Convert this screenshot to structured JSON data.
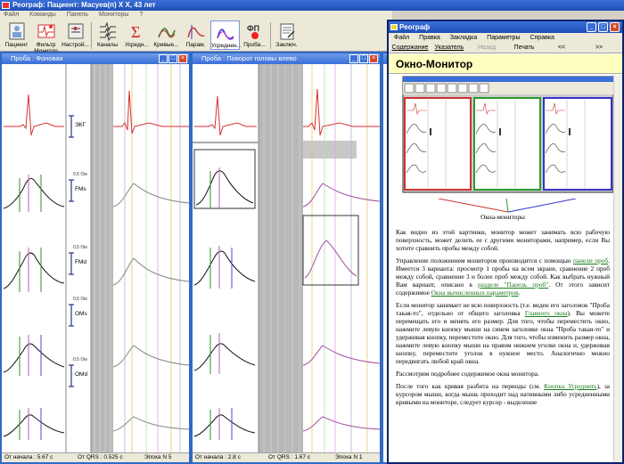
{
  "main_window": {
    "title": "Реограф: Пациент: Масуев(п) Х Х, 43 лет",
    "menu": [
      "Файл",
      "Команды",
      "Панель",
      "Мониторы",
      "?"
    ],
    "toolbar": [
      {
        "label": "Пациент",
        "icon": "patient-icon"
      },
      {
        "label": "Фильтр Монитор",
        "icon": "monitor-filter-icon"
      },
      {
        "label": "Настрой...",
        "icon": "settings-icon"
      },
      {
        "label": "Каналы",
        "icon": "channels-icon"
      },
      {
        "label": "Усредн...",
        "icon": "sigma-icon"
      },
      {
        "label": "Кривые...",
        "icon": "curves-icon"
      },
      {
        "label": "Парам.",
        "icon": "params-icon"
      },
      {
        "label": "Усреднен...",
        "icon": "averaged-icon"
      },
      {
        "label": "Проба...",
        "icon": "probe-icon"
      },
      {
        "label": "Заключ.",
        "icon": "conclusion-icon"
      }
    ]
  },
  "monitors": [
    {
      "title": "Проба : Фоновая",
      "status": {
        "start": "От начала : 5.67 с",
        "qrs": "От QRS : 0.525 с",
        "epoch": "Эпоха N 5"
      }
    },
    {
      "title": "Проба : Поворот головы влево",
      "status": {
        "start": "От начала : 2.8 с",
        "qrs": "От QRS : 1.67 с",
        "epoch": "Эпоха N 1"
      }
    }
  ],
  "leads": [
    {
      "label": "ЭКГ",
      "scale": ""
    },
    {
      "label": "FMs",
      "scale": "0,5 Ом"
    },
    {
      "label": "FMd",
      "scale": "0,5 Ом"
    },
    {
      "label": "OMs",
      "scale": "0,5 Ом"
    },
    {
      "label": "OMd",
      "scale": "0,5 Ом"
    }
  ],
  "help": {
    "title": "Реограф",
    "menu": [
      "Файл",
      "Правка",
      "Закладка",
      "Параметры",
      "Справка"
    ],
    "nav": [
      "Содержание",
      "Указатель",
      "Назад",
      "Печать",
      "<<",
      ">>"
    ],
    "heading": "Окно-Монитор",
    "caption": "Окна-мониторы",
    "p1": "Как видно из этой картинки, монитор может занимать всю рабочую поверхность, может делить ее с другими мониторами, например, если Вы хотите сравнить пробы между собой.",
    "p2a": "Управление положением мониторов производится с помощью ",
    "p2_link1": "панели проб",
    "p2b": ". Имеется 3 варианта: просмотр 1 пробы на всем экране, сравнение 2 проб между собой, сравнение 3 и более проб между собой. Как выбрать нужный Вам вариант, описано в ",
    "p2_link2": "разделе \"Панель проб\"",
    "p2c": ". От этого зависит содержимое ",
    "p2_link3": "Окна вычисленных параметров",
    "p2d": ".",
    "p3a": "Если монитор занимает не всю поверхность (т.е. виден его заголовок \"Проба такая-то\", отдельно от общего заголовка ",
    "p3_link": "Главного окна",
    "p3b": "). Вы можете перемещать его и менять его размер. Для того, чтобы переместить окно, нажмите левую кнопку мыши на синем заголовке окна \"Проба такая-то\" и удерживая кнопку, переместите окно. Для того, чтобы изменить размер окна, нажмите левую кнопку мыши на правом нижнем уголке окна и, удерживая кнопку, переместите уголок в нужное место. Аналогично можно передвигать любой край окна.",
    "p4": "Рассмотрим подробнее содержимое окна монитора.",
    "p5a": "После того как кривая разбита на периоды (см. ",
    "p5_link": "Кнопка Усреднить",
    "p5b": "), за курсором мыши, когда мышь проходит над нативными либо усредненными кривыми на мониторе, следует курсор - выделение"
  },
  "colors": {
    "title_blue": "#3a6fd8",
    "ecg": "#e03030",
    "trace": "#111111",
    "link": "#1a7a1a"
  }
}
